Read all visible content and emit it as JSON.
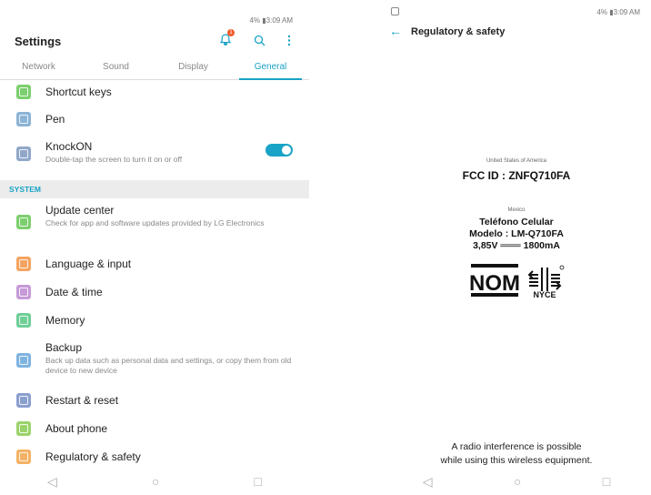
{
  "left": {
    "status": "4% ▮3:09 AM",
    "title": "Settings",
    "tabs": [
      "Network",
      "Sound",
      "Display",
      "General"
    ],
    "items_top": [
      {
        "label": "Shortcut keys",
        "icon": "shortcut-keys-icon",
        "color": "#7ccf6e"
      },
      {
        "label": "Pen",
        "icon": "pen-icon",
        "color": "#8cb4d6"
      },
      {
        "label": "KnockON",
        "sub": "Double-tap the screen to turn it on or off",
        "icon": "knockon-icon",
        "color": "#8fa7c9",
        "toggle": true
      }
    ],
    "section": "SYSTEM",
    "items_system": [
      {
        "label": "Update center",
        "sub": "Check for app and software updates provided by LG Electronics",
        "icon": "update-center-icon",
        "color": "#7ccf6e"
      },
      {
        "label": "Language & input",
        "icon": "language-icon",
        "color": "#f4a460"
      },
      {
        "label": "Date & time",
        "icon": "date-time-icon",
        "color": "#c79ad8"
      },
      {
        "label": "Memory",
        "icon": "memory-icon",
        "color": "#6fcf97"
      },
      {
        "label": "Backup",
        "sub": "Back up data such as personal data and settings, or copy them from old device to new device",
        "icon": "backup-icon",
        "color": "#7fb3e0"
      },
      {
        "label": "Restart & reset",
        "icon": "restart-icon",
        "color": "#8b9fcf"
      },
      {
        "label": "About phone",
        "icon": "about-phone-icon",
        "color": "#9bd36b"
      },
      {
        "label": "Regulatory & safety",
        "icon": "regulatory-icon",
        "color": "#f4b266"
      }
    ],
    "badge": "1"
  },
  "right": {
    "status": "4% ▮3:09 AM",
    "title": "Regulatory & safety",
    "us_label": "United States of America",
    "fcc": "FCC ID : ZNFQ710FA",
    "mexico_label": "Mexico",
    "phone_type": "Teléfono Celular",
    "model": "Modelo : LM-Q710FA",
    "power": "3,85V ═══ 1800mA",
    "nom": "NOM",
    "nyce": "NYCE",
    "footer_line1": "A radio interference is possible",
    "footer_line2": "while using this wireless equipment."
  },
  "nav": [
    "◁",
    "○",
    "□"
  ],
  "colors": {
    "accent": "#19a3c6"
  }
}
